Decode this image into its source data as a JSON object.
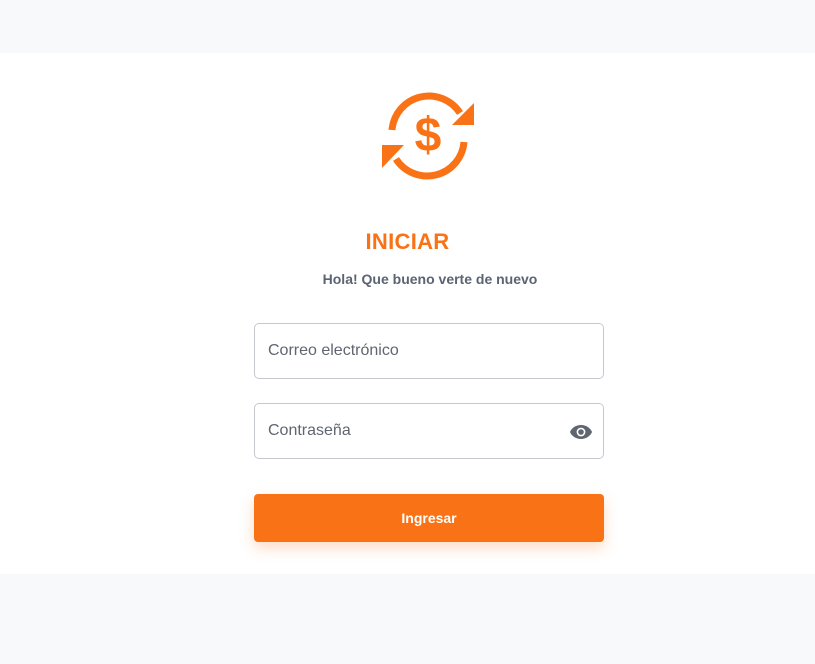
{
  "login": {
    "title": "INICIAR",
    "subtitle": "Hola! Que bueno verte de nuevo",
    "email": {
      "placeholder": "Correo electrónico",
      "value": ""
    },
    "password": {
      "placeholder": "Contraseña",
      "value": "",
      "toggle_icon": "eye-icon"
    },
    "submit_label": "Ingresar",
    "logo_icon": "dollar-exchange-icon"
  },
  "colors": {
    "accent": "#f97316",
    "page_background": "#f8f9fb",
    "card_background": "#ffffff",
    "subtitle_text": "#5b6472",
    "field_border": "#c5c9cf",
    "icon_gray": "#5f6670"
  }
}
